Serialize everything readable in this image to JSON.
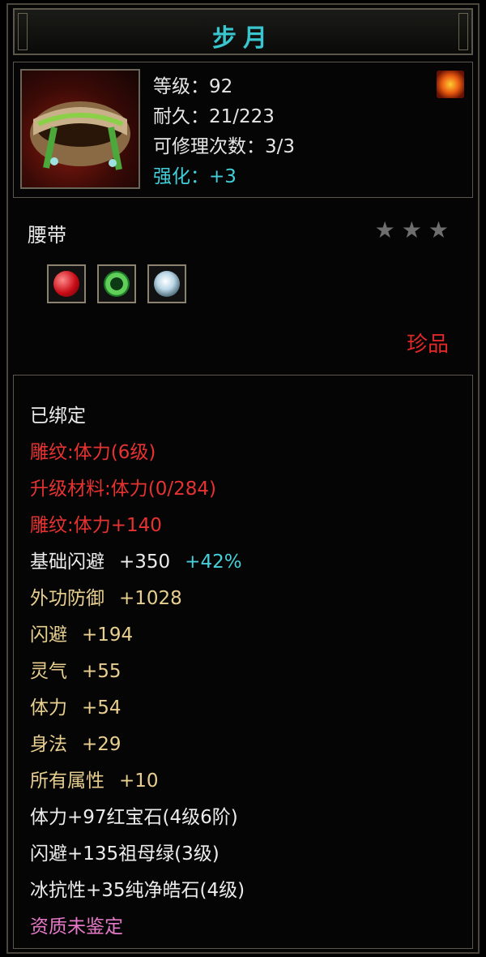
{
  "title": "步月",
  "item": {
    "icon": "belt-icon",
    "level": "等级：92",
    "durability": "耐久：21/223",
    "repairs": "可修理次数：3/3",
    "enhance": "强化：+3",
    "corner_icon": "fire-icon",
    "type": "腰带",
    "stars": 3,
    "gems": [
      "ruby",
      "emerald",
      "diamond"
    ],
    "rarity": "珍品"
  },
  "attributes": {
    "bound": "已绑定",
    "engrave_level": "雕纹:体力(6级)",
    "upgrade_material": "升级材料:体力(0/284)",
    "engrave_bonus": "雕纹:体力+140",
    "base_dodge": "基础闪避",
    "base_dodge_value": "+350",
    "base_dodge_pct": "+42%",
    "outer_defense": "外功防御",
    "outer_defense_value": "+1028",
    "dodge": "闪避",
    "dodge_value": "+194",
    "spirit": "灵气",
    "spirit_value": "+55",
    "stamina": "体力",
    "stamina_value": "+54",
    "agility": "身法",
    "agility_value": "+29",
    "all_attr": "所有属性",
    "all_attr_value": "+10",
    "gem1": "体力+97红宝石(4级6阶)",
    "gem2": "闪避+135祖母绿(3级)",
    "gem3": "冰抗性+35纯净皓石(4级)",
    "quality": "资质未鉴定"
  },
  "colors": {
    "title": "#39c6cf",
    "red": "#e73232",
    "gold": "#e8cf8f",
    "cyan": "#46d0da",
    "pink": "#e579c8"
  }
}
